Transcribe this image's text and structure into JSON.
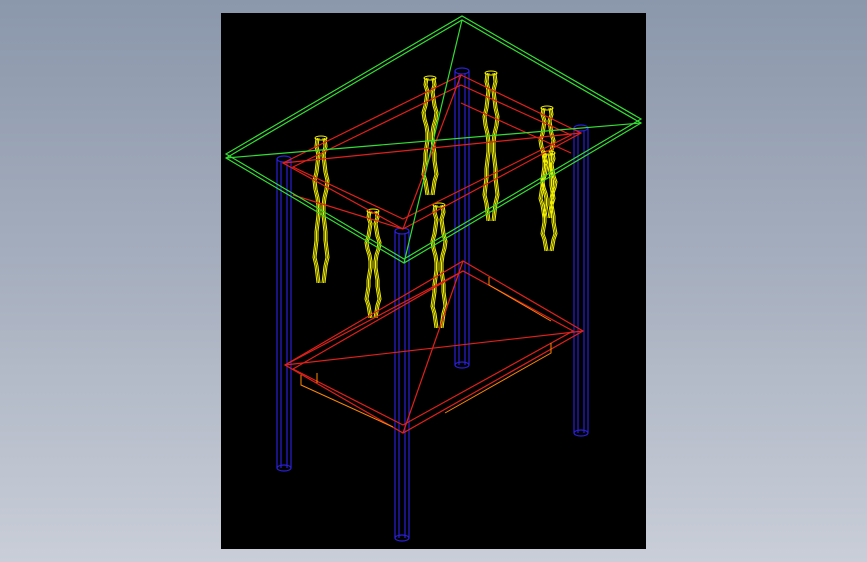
{
  "viewer": {
    "background_color": "#000000",
    "colors": {
      "top_panel": "#33dd33",
      "frame": "#e0201a",
      "legs": "#2a1fd6",
      "spindles": "#f2f000",
      "inner_trim": "#ff8800"
    },
    "object_description": ""
  }
}
